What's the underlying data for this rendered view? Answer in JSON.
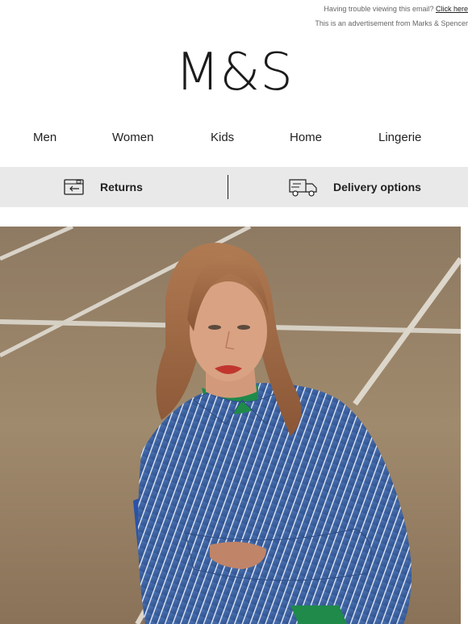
{
  "prelude": {
    "trouble_text": "Having trouble viewing this email?",
    "click_here": "Click here",
    "ad_text": "This is an advertisement from Marks & Spencer"
  },
  "logo": {
    "text": "M&S"
  },
  "nav": {
    "items": [
      {
        "label": "Men"
      },
      {
        "label": "Women"
      },
      {
        "label": "Kids"
      },
      {
        "label": "Home"
      },
      {
        "label": "Lingerie"
      }
    ]
  },
  "service": {
    "returns_label": "Returns",
    "returns_icon": "returns-card-icon",
    "delivery_label": "Delivery options",
    "delivery_icon": "delivery-truck-icon",
    "background": "#e9e9e9"
  },
  "hero": {
    "description_icon": "hero-photo"
  }
}
